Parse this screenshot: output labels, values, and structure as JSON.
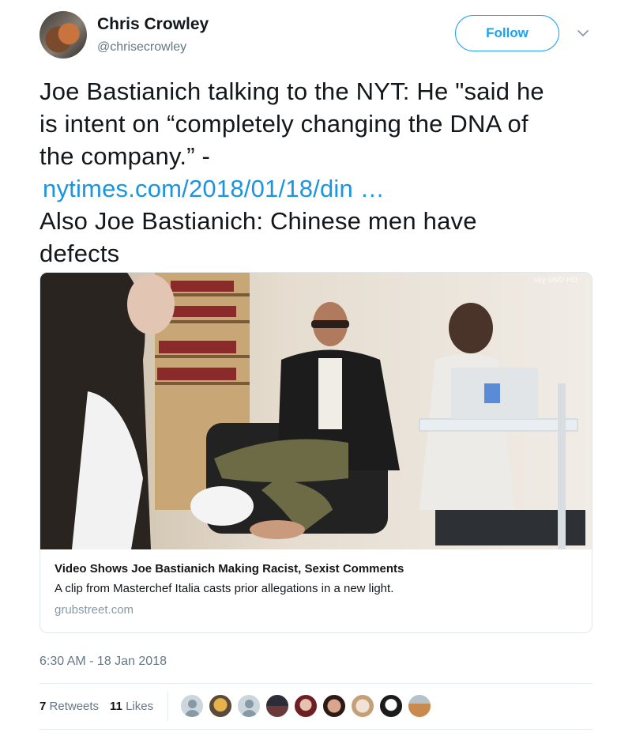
{
  "author": {
    "name": "Chris Crowley",
    "handle": "@chrisecrowley"
  },
  "follow_label": "Follow",
  "tweet": {
    "lines": [
      "Joe Bastianich talking to the NYT: He \"said he",
      "is intent on “completely changing the DNA of",
      "the company.” -"
    ],
    "link": "nytimes.com/2018/01/18/din …",
    "lines_after": [
      "Also Joe Bastianich: Chinese men have",
      "defects"
    ]
  },
  "card": {
    "title": "Video Shows Joe Bastianich Making Racist, Sexist Comments",
    "description": "A clip from Masterchef Italia casts prior allegations in a new light.",
    "domain": "grubstreet.com"
  },
  "timestamp": "6:30 AM - 18 Jan 2018",
  "stats": {
    "retweets_count": "7",
    "retweets_label": "Retweets",
    "likes_count": "11",
    "likes_label": "Likes"
  },
  "likers": [
    "default-avatar",
    "user-avatar",
    "default-avatar",
    "user-avatar",
    "user-avatar",
    "user-avatar",
    "user-avatar",
    "user-avatar",
    "user-avatar"
  ],
  "colors": {
    "accent": "#1da1f2",
    "link": "#1b95e0",
    "secondary_text": "#657786"
  }
}
